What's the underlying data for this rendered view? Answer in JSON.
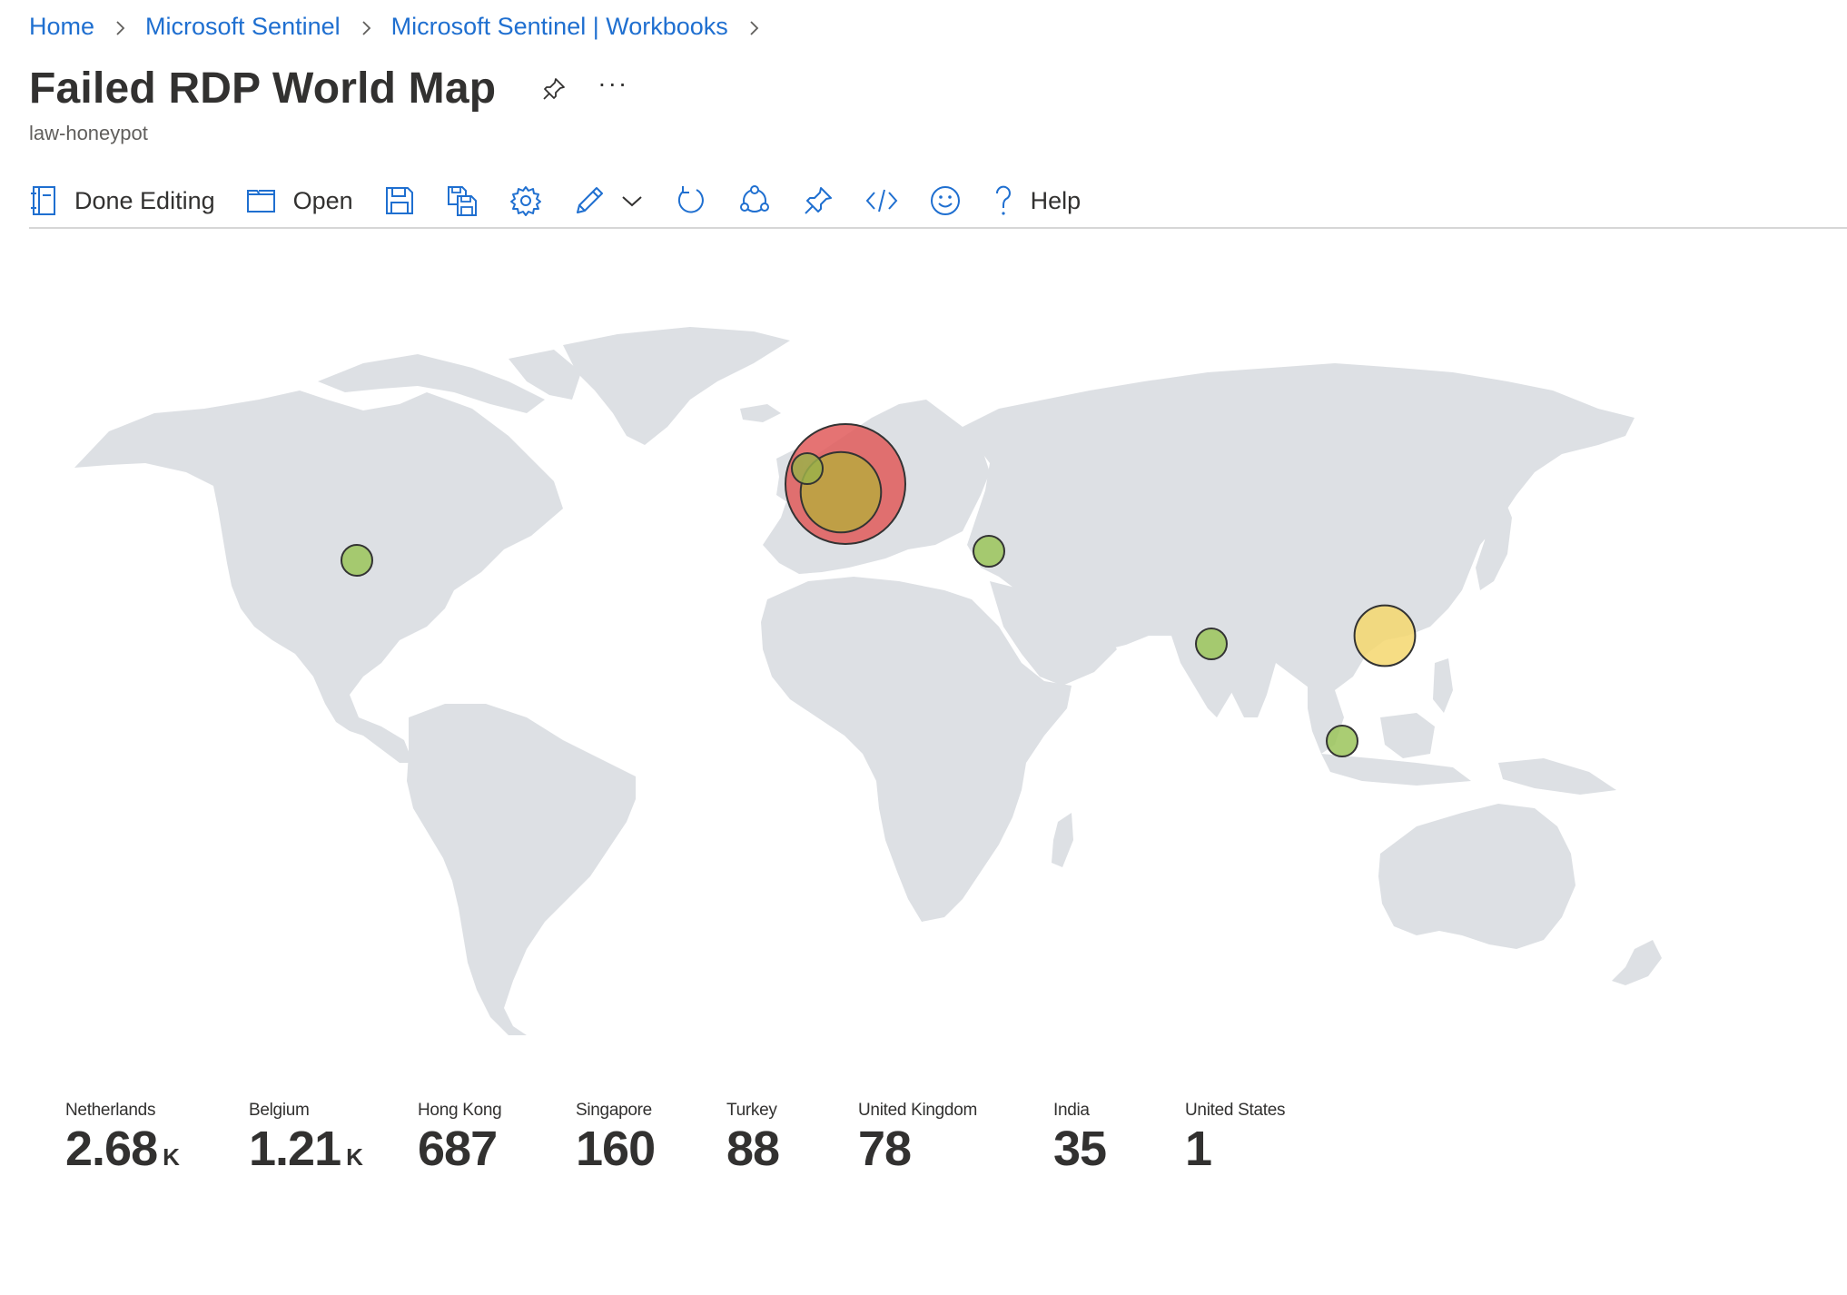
{
  "breadcrumb": {
    "items": [
      "Home",
      "Microsoft Sentinel",
      "Microsoft Sentinel | Workbooks"
    ]
  },
  "header": {
    "title": "Failed RDP World Map",
    "subtitle": "law-honeypot",
    "pin_icon": "pin-icon",
    "more_label": "···"
  },
  "toolbar": {
    "done_editing_label": "Done Editing",
    "open_label": "Open",
    "help_label": "Help",
    "accent": "#1f6fd0",
    "icons": [
      "done-editing-icon",
      "open-folder-icon",
      "save-icon",
      "save-as-icon",
      "gear-icon",
      "pencil-icon",
      "chevron-down-icon",
      "refresh-icon",
      "share-icon",
      "pin-icon",
      "code-icon",
      "smiley-icon",
      "help-icon"
    ]
  },
  "map": {
    "land_color": "#dde0e4",
    "points": [
      {
        "country": "Netherlands",
        "count": 2680,
        "color": "#e05a5a"
      },
      {
        "country": "Belgium",
        "count": 1210,
        "color": "#b8a840"
      },
      {
        "country": "Hong Kong",
        "count": 687,
        "color": "#f5d76e"
      },
      {
        "country": "Singapore",
        "count": 160,
        "color": "#9bc45a"
      },
      {
        "country": "Turkey",
        "count": 88,
        "color": "#9bc45a"
      },
      {
        "country": "United Kingdom",
        "count": 78,
        "color": "#9bb04a"
      },
      {
        "country": "India",
        "count": 35,
        "color": "#9bc45a"
      },
      {
        "country": "United States",
        "count": 1,
        "color": "#9bc45a"
      }
    ]
  },
  "tiles": [
    {
      "label": "Netherlands",
      "value": "2.68",
      "unit": "K"
    },
    {
      "label": "Belgium",
      "value": "1.21",
      "unit": "K"
    },
    {
      "label": "Hong Kong",
      "value": "687",
      "unit": ""
    },
    {
      "label": "Singapore",
      "value": "160",
      "unit": ""
    },
    {
      "label": "Turkey",
      "value": "88",
      "unit": ""
    },
    {
      "label": "United Kingdom",
      "value": "78",
      "unit": ""
    },
    {
      "label": "India",
      "value": "35",
      "unit": ""
    },
    {
      "label": "United States",
      "value": "1",
      "unit": ""
    }
  ]
}
